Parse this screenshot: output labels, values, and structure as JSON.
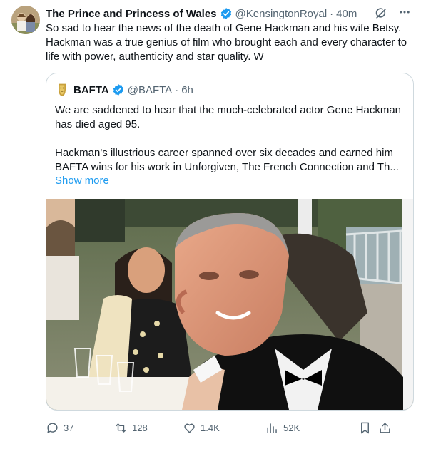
{
  "tweet": {
    "author_name": "The Prince and Princess of Wales",
    "handle": "@KensingtonRoyal",
    "separator": "·",
    "time": "40m",
    "text": "So sad to hear the news of the death of Gene Hackman and his wife Betsy. Hackman was a true genius of film who brought each and every character to life with power, authenticity and star quality. W"
  },
  "quote": {
    "author_name": "BAFTA",
    "handle": "@BAFTA",
    "separator": "·",
    "time": "6h",
    "paragraph1": "We are saddened to hear that the much-celebrated actor Gene Hackman has died aged 95.",
    "paragraph2": "Hackman's illustrious career spanned over six decades and earned him BAFTA wins for his work in Unforgiven, The French Connection and Th...",
    "show_more": "Show more"
  },
  "metrics": {
    "replies": "37",
    "reposts": "128",
    "likes": "1.4K",
    "views": "52K"
  },
  "colors": {
    "text": "#0f1419",
    "secondary": "#536471",
    "link": "#1d9bf0",
    "border": "#cfd9de",
    "verified_blue": "#1d9bf0"
  },
  "icons": [
    "verified-icon",
    "grok-icon",
    "more-icon",
    "bafta-mask-icon",
    "reply-icon",
    "repost-icon",
    "like-icon",
    "views-icon",
    "bookmark-icon",
    "share-icon"
  ]
}
